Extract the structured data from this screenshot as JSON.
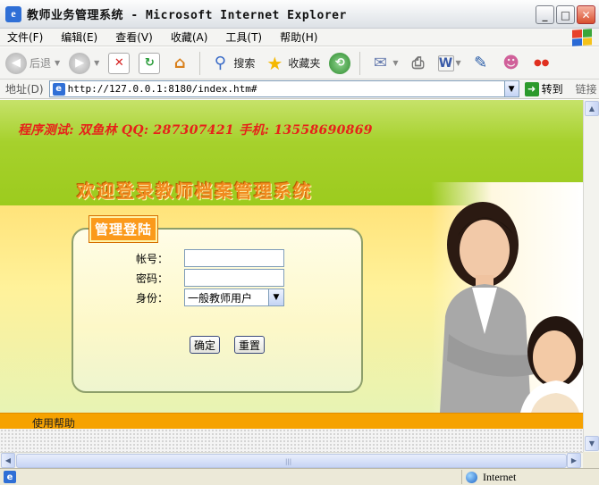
{
  "window": {
    "title": "教师业务管理系统 - Microsoft Internet Explorer",
    "min_glyph": "_",
    "max_glyph": "□",
    "close_glyph": "✕"
  },
  "menu": [
    "文件(F)",
    "编辑(E)",
    "查看(V)",
    "收藏(A)",
    "工具(T)",
    "帮助(H)"
  ],
  "toolbar": {
    "back": "后退",
    "search": "搜索",
    "favorites": "收藏夹"
  },
  "address": {
    "label": "地址(D)",
    "url": "http://127.0.0.1:8180/index.htm#",
    "go": "转到",
    "links": "链接"
  },
  "page": {
    "credits": "程序测试: 双鱼林   QQ: 287307421  手机: 13558690869",
    "welcome": "欢迎登录教师档案管理系统",
    "panel_title": "管理登陆",
    "form": {
      "account_label": "帐号：",
      "account_value": "",
      "password_label": "密码：",
      "password_value": "",
      "identity_label": "身份：",
      "identity_selected": "一般教师用户",
      "confirm": "确定",
      "reset": "重置"
    },
    "footer_link": "使用帮助"
  },
  "status": {
    "zone": "Internet"
  },
  "colors": {
    "banner_green": "#a6d12c",
    "credits_red": "#e6221a",
    "welcome_orange": "#f08a1e",
    "footer_orange": "#f6a200",
    "panel_title_orange": "#fb9a1b"
  }
}
